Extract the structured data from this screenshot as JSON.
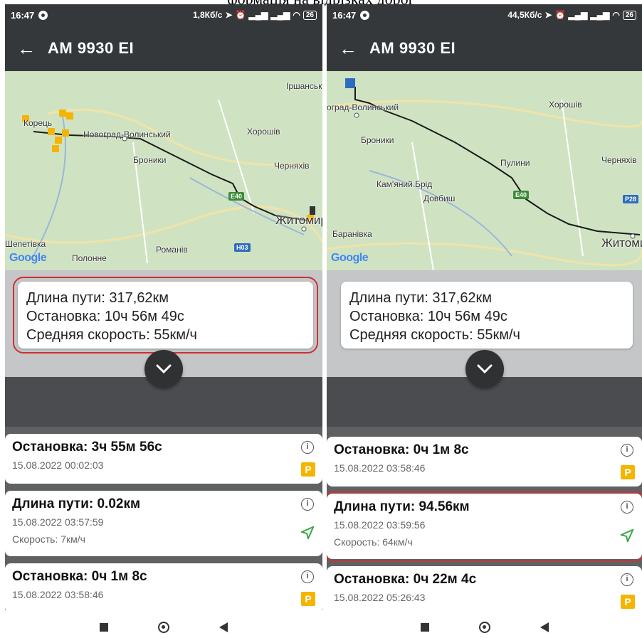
{
  "caption": "формація на відрізках дорог",
  "left": {
    "status": {
      "time": "16:47",
      "net": "1,8Кб/с",
      "battery": "26"
    },
    "app_title": "AM 9930 EI",
    "map_labels": {
      "irshansk": "Іршанськ",
      "korets": "Корець",
      "novograd": "Новоград-Волинський",
      "khoroshiv": "Хорошів",
      "bronyky": "Броники",
      "chernyakhiv": "Черняхів",
      "zhytomyr": "Житомир",
      "shepetivka": "Шепетівка",
      "polonne": "Полонне",
      "romaniv": "Романів",
      "road_e40": "E40",
      "road_h03": "H03"
    },
    "summary": {
      "distance": "Длина пути: 317,62км",
      "stop": "Остановка: 10ч 56м 49с",
      "speed": "Средняя скорость: 55км/ч"
    },
    "items": [
      {
        "title": "Остановка: 3ч 55м 56с",
        "date": "15.08.2022 00:02:03"
      },
      {
        "title": "Длина пути: 0.02км",
        "date": "15.08.2022 03:57:59",
        "speed": "Скорость: 7км/ч"
      },
      {
        "title": "Остановка: 0ч 1м 8с",
        "date": "15.08.2022 03:58:46"
      }
    ]
  },
  "right": {
    "status": {
      "time": "16:47",
      "net": "44,5Кб/с",
      "battery": "26"
    },
    "app_title": "AM 9930 EI",
    "map_labels": {
      "novograd": "оград-Волинський",
      "khoroshiv": "Хорошів",
      "bronyky": "Броники",
      "pulyny": "Пулини",
      "chernyakh": "Черняхів",
      "kamyaniy": "Кам'яний Брід",
      "dovbysh": "Довбиш",
      "baranivka": "Баранівка",
      "zhytomyr": "Житомир",
      "road_e40": "E40",
      "road_p28": "P28"
    },
    "summary": {
      "distance": "Длина пути: 317,62км",
      "stop": "Остановка: 10ч 56м 49с",
      "speed": "Средняя скорость: 55км/ч"
    },
    "items": [
      {
        "title": "Остановка: 0ч 1м 8с",
        "date": "15.08.2022 03:58:46"
      },
      {
        "title": "Длина пути: 94.56км",
        "date": "15.08.2022 03:59:56",
        "speed": "Скорость: 64км/ч"
      },
      {
        "title": "Остановка: 0ч 22м 4с",
        "date": "15.08.2022 05:26:43"
      }
    ]
  },
  "google": "Google",
  "icons": {
    "back": "arrow-left-icon",
    "info": "info-icon",
    "parking": "parking-icon",
    "navigation": "navigation-arrow-icon",
    "chevron": "chevron-down-icon"
  },
  "nav_labels": {
    "info_glyph": "i",
    "parking_glyph": "P"
  }
}
